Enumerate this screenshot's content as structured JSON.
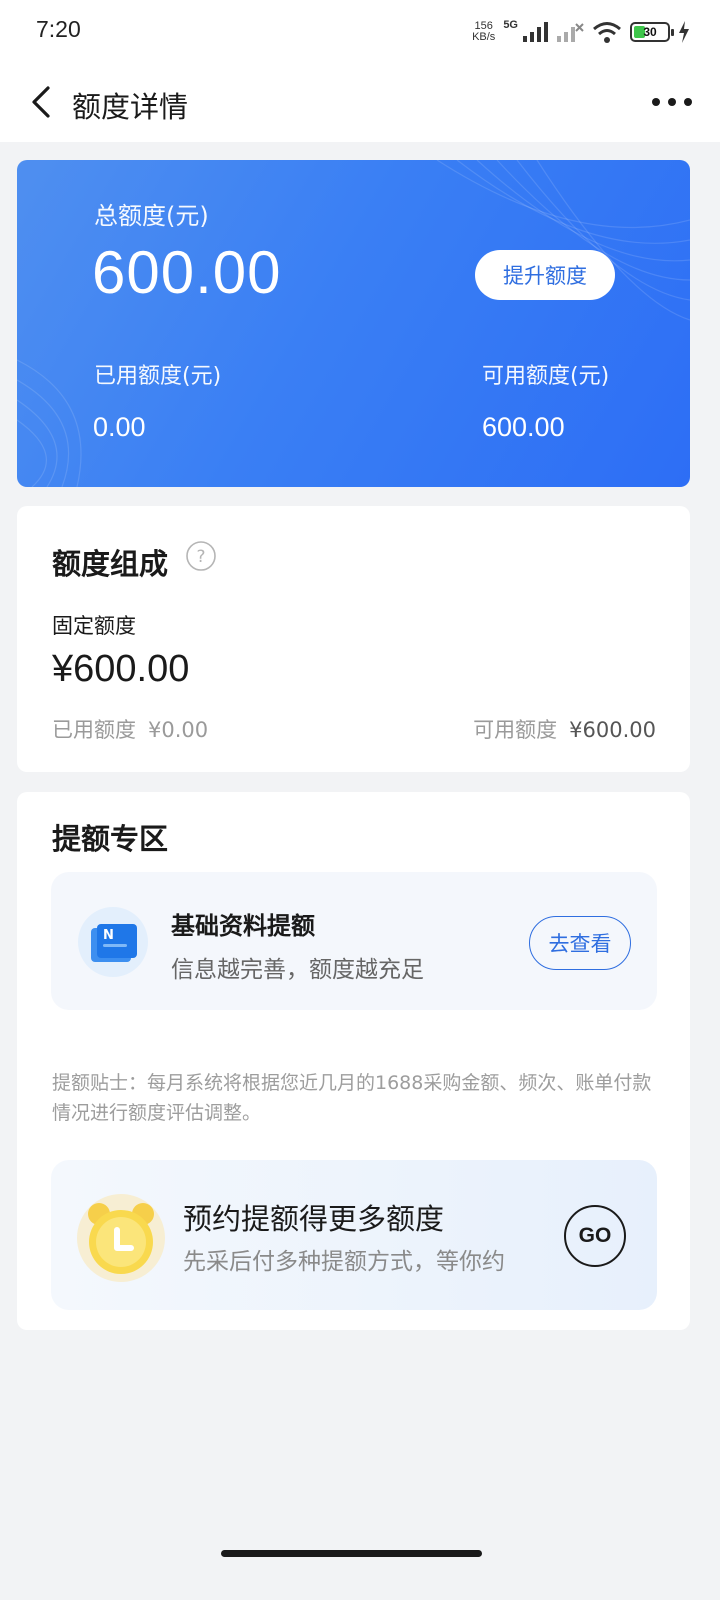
{
  "status_bar": {
    "time": "7:20",
    "net_speed_value": "156",
    "net_speed_unit": "KB/s",
    "signal_label": "5G",
    "battery_level": "30"
  },
  "nav": {
    "title": "额度详情"
  },
  "hero": {
    "total_label": "总额度(元)",
    "total_value": "600.00",
    "raise_button": "提升额度",
    "used_label": "已用额度(元)",
    "used_value": "0.00",
    "available_label": "可用额度(元)",
    "available_value": "600.00",
    "colors": {
      "start": "#4f8ff0",
      "end": "#2d6ef5"
    }
  },
  "composition": {
    "title": "额度组成",
    "help_icon": "question-circle-icon",
    "fixed_label": "固定额度",
    "fixed_value": "¥600.00",
    "used_label": "已用额度",
    "used_value": "¥0.00",
    "available_label": "可用额度",
    "available_value": "¥600.00"
  },
  "zone": {
    "title": "提额专区",
    "basic": {
      "icon": "document-icon",
      "title": "基础资料提额",
      "subtitle": "信息越完善，额度越充足",
      "button": "去查看"
    },
    "tip": "提额贴士：每月系统将根据您近几月的1688采购金额、频次、账单付款情况进行额度评估调整。",
    "reserve": {
      "icon": "alarm-clock-icon",
      "title": "预约提额得更多额度",
      "subtitle": "先采后付多种提额方式，等你约",
      "button": "GO"
    }
  },
  "accent_color": "#2f6ee0"
}
